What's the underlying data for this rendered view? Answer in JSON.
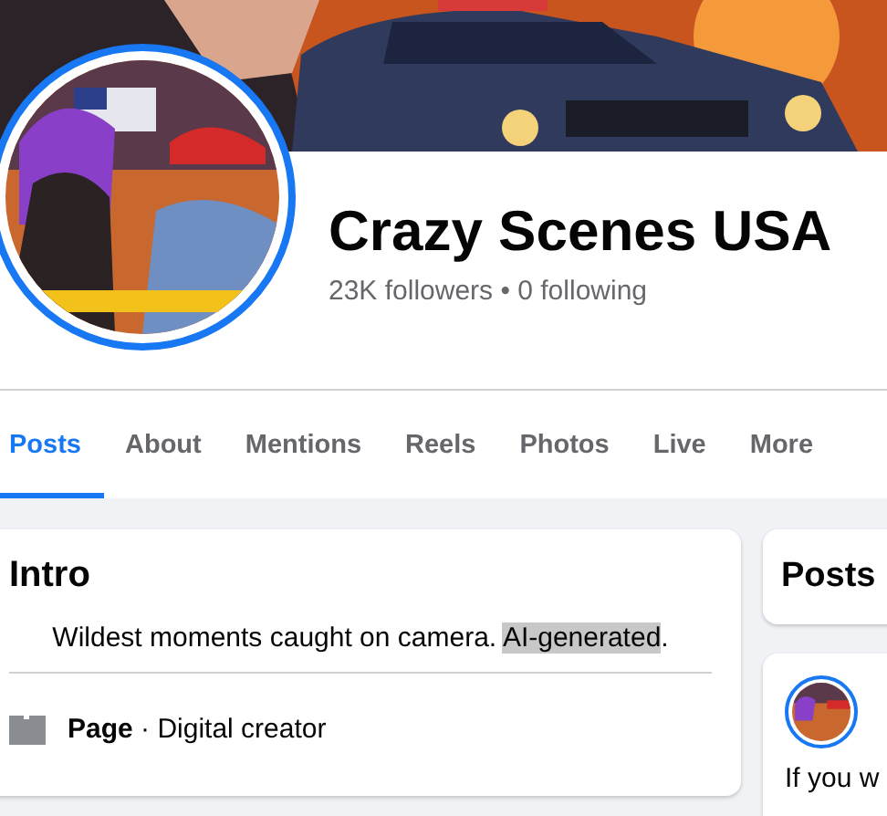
{
  "profile": {
    "name": "Crazy Scenes USA",
    "stats": "23K followers • 0 following",
    "story_ring": true
  },
  "tabs": [
    {
      "label": "Posts",
      "selected": true
    },
    {
      "label": "About",
      "selected": false
    },
    {
      "label": "Mentions",
      "selected": false
    },
    {
      "label": "Reels",
      "selected": false
    },
    {
      "label": "Photos",
      "selected": false
    },
    {
      "label": "Live",
      "selected": false
    },
    {
      "label": "More",
      "selected": false
    }
  ],
  "intro": {
    "title": "Intro",
    "description": [
      {
        "text": "Wildest moments caught on camera. ",
        "highlighted": false
      },
      {
        "text": "AI-generated",
        "highlighted": true
      },
      {
        "text": ".",
        "highlighted": false
      }
    ],
    "category_label": "Page",
    "category": "· Digital creator"
  },
  "posts_panel": {
    "title": "Posts"
  },
  "post": {
    "story_ring": true,
    "text": "If you w"
  }
}
